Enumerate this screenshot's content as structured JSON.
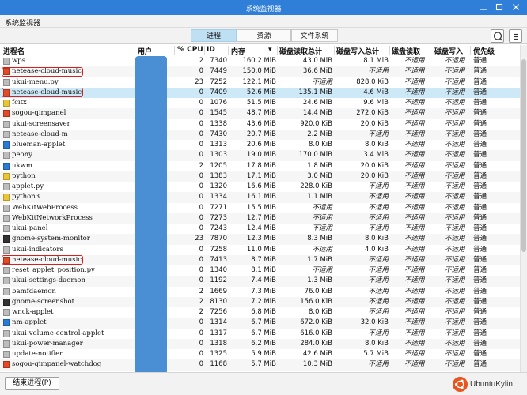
{
  "window": {
    "title": "系统监视器"
  },
  "menubar": {
    "app_label": "系统监视器"
  },
  "tabs": [
    {
      "label": "进程",
      "active": true
    },
    {
      "label": "资源",
      "active": false
    },
    {
      "label": "文件系统",
      "active": false
    }
  ],
  "toolbar": {
    "search_icon": "search-icon",
    "menu_icon": "menu-icon"
  },
  "columns": {
    "name": "进程名",
    "user": "用户",
    "cpu": "% CPU",
    "id": "ID",
    "memory": "内存",
    "disk_read_total": "磁盘读取总计",
    "disk_write_total": "磁盘写入总计",
    "disk_read": "磁盘读取",
    "disk_write": "磁盘写入",
    "priority": "优先级",
    "sort_indicator": "▾"
  },
  "processes": [
    {
      "icon": "gray",
      "name": "wps",
      "cpu": "2",
      "id": "7340",
      "mem": "160.2 MiB",
      "rtotal": "43.0 MiB",
      "wtotal": "8.1 MiB",
      "read": "不适用",
      "write": "不适用",
      "priority": "普通"
    },
    {
      "icon": "music",
      "name": "netease-cloud-music",
      "cpu": "0",
      "id": "7449",
      "mem": "150.0 MiB",
      "rtotal": "36.6 MiB",
      "wtotal": "不适用",
      "read": "不适用",
      "write": "不适用",
      "priority": "普通"
    },
    {
      "icon": "gray",
      "name": "ukui-menu.py",
      "cpu": "23",
      "id": "7252",
      "mem": "122.1 MiB",
      "rtotal": "不适用",
      "wtotal": "828.0 KiB",
      "read": "不适用",
      "write": "不适用",
      "priority": "普通"
    },
    {
      "icon": "music",
      "name": "netease-cloud-music",
      "cpu": "0",
      "id": "7409",
      "mem": "52.6 MiB",
      "rtotal": "135.1 MiB",
      "wtotal": "4.6 MiB",
      "read": "不适用",
      "write": "不适用",
      "priority": "普通"
    },
    {
      "icon": "yellow",
      "name": "fcitx",
      "cpu": "0",
      "id": "1076",
      "mem": "51.5 MiB",
      "rtotal": "24.6 MiB",
      "wtotal": "9.6 MiB",
      "read": "不适用",
      "write": "不适用",
      "priority": "普通"
    },
    {
      "icon": "music",
      "name": "sogou-qimpanel",
      "cpu": "0",
      "id": "1545",
      "mem": "48.7 MiB",
      "rtotal": "14.4 MiB",
      "wtotal": "272.0 KiB",
      "read": "不适用",
      "write": "不适用",
      "priority": "普通"
    },
    {
      "icon": "gray",
      "name": "ukui-screensaver",
      "cpu": "0",
      "id": "1338",
      "mem": "43.6 MiB",
      "rtotal": "920.0 KiB",
      "wtotal": "20.0 KiB",
      "read": "不适用",
      "write": "不适用",
      "priority": "普通"
    },
    {
      "icon": "gray",
      "name": "netease-cloud-m",
      "cpu": "0",
      "id": "7430",
      "mem": "20.7 MiB",
      "rtotal": "2.2 MiB",
      "wtotal": "不适用",
      "read": "不适用",
      "write": "不适用",
      "priority": "普通"
    },
    {
      "icon": "blue",
      "name": "blueman-applet",
      "cpu": "0",
      "id": "1313",
      "mem": "20.6 MiB",
      "rtotal": "8.0 KiB",
      "wtotal": "8.0 KiB",
      "read": "不适用",
      "write": "不适用",
      "priority": "普通"
    },
    {
      "icon": "gray",
      "name": "peony",
      "cpu": "0",
      "id": "1303",
      "mem": "19.0 MiB",
      "rtotal": "170.0 MiB",
      "wtotal": "3.4 MiB",
      "read": "不适用",
      "write": "不适用",
      "priority": "普通"
    },
    {
      "icon": "blue",
      "name": "ukwm",
      "cpu": "2",
      "id": "1205",
      "mem": "17.8 MiB",
      "rtotal": "1.8 MiB",
      "wtotal": "20.0 KiB",
      "read": "不适用",
      "write": "不适用",
      "priority": "普通"
    },
    {
      "icon": "yellow",
      "name": "python",
      "cpu": "0",
      "id": "1383",
      "mem": "17.1 MiB",
      "rtotal": "3.0 MiB",
      "wtotal": "20.0 KiB",
      "read": "不适用",
      "write": "不适用",
      "priority": "普通"
    },
    {
      "icon": "gray",
      "name": "applet.py",
      "cpu": "0",
      "id": "1320",
      "mem": "16.6 MiB",
      "rtotal": "228.0 KiB",
      "wtotal": "不适用",
      "read": "不适用",
      "write": "不适用",
      "priority": "普通"
    },
    {
      "icon": "yellow",
      "name": "python3",
      "cpu": "0",
      "id": "1334",
      "mem": "16.1 MiB",
      "rtotal": "1.1 MiB",
      "wtotal": "不适用",
      "read": "不适用",
      "write": "不适用",
      "priority": "普通"
    },
    {
      "icon": "gray",
      "name": "WebKitWebProcess",
      "cpu": "0",
      "id": "7271",
      "mem": "15.5 MiB",
      "rtotal": "不适用",
      "wtotal": "不适用",
      "read": "不适用",
      "write": "不适用",
      "priority": "普通"
    },
    {
      "icon": "gray",
      "name": "WebKitNetworkProcess",
      "cpu": "0",
      "id": "7273",
      "mem": "12.7 MiB",
      "rtotal": "不适用",
      "wtotal": "不适用",
      "read": "不适用",
      "write": "不适用",
      "priority": "普通"
    },
    {
      "icon": "gray",
      "name": "ukui-panel",
      "cpu": "0",
      "id": "7243",
      "mem": "12.4 MiB",
      "rtotal": "不适用",
      "wtotal": "不适用",
      "read": "不适用",
      "write": "不适用",
      "priority": "普通"
    },
    {
      "icon": "dark",
      "name": "gnome-system-monitor",
      "cpu": "23",
      "id": "7870",
      "mem": "12.3 MiB",
      "rtotal": "8.3 MiB",
      "wtotal": "8.0 KiB",
      "read": "不适用",
      "write": "不适用",
      "priority": "普通"
    },
    {
      "icon": "gray",
      "name": "ukui-indicators",
      "cpu": "0",
      "id": "7258",
      "mem": "11.0 MiB",
      "rtotal": "不适用",
      "wtotal": "4.0 KiB",
      "read": "不适用",
      "write": "不适用",
      "priority": "普通"
    },
    {
      "icon": "music",
      "name": "netease-cloud-music",
      "cpu": "0",
      "id": "7413",
      "mem": "8.7 MiB",
      "rtotal": "1.7 MiB",
      "wtotal": "不适用",
      "read": "不适用",
      "write": "不适用",
      "priority": "普通"
    },
    {
      "icon": "gray",
      "name": "reset_applet_position.py",
      "cpu": "0",
      "id": "1340",
      "mem": "8.1 MiB",
      "rtotal": "不适用",
      "wtotal": "不适用",
      "read": "不适用",
      "write": "不适用",
      "priority": "普通"
    },
    {
      "icon": "gray",
      "name": "ukui-settings-daemon",
      "cpu": "0",
      "id": "1192",
      "mem": "7.4 MiB",
      "rtotal": "1.3 MiB",
      "wtotal": "不适用",
      "read": "不适用",
      "write": "不适用",
      "priority": "普通"
    },
    {
      "icon": "gray",
      "name": "bamfdaemon",
      "cpu": "2",
      "id": "1669",
      "mem": "7.3 MiB",
      "rtotal": "76.0 KiB",
      "wtotal": "不适用",
      "read": "不适用",
      "write": "不适用",
      "priority": "普通"
    },
    {
      "icon": "dark",
      "name": "gnome-screenshot",
      "cpu": "2",
      "id": "8130",
      "mem": "7.2 MiB",
      "rtotal": "156.0 KiB",
      "wtotal": "不适用",
      "read": "不适用",
      "write": "不适用",
      "priority": "普通"
    },
    {
      "icon": "gray",
      "name": "wnck-applet",
      "cpu": "2",
      "id": "7256",
      "mem": "6.8 MiB",
      "rtotal": "8.0 KiB",
      "wtotal": "不适用",
      "read": "不适用",
      "write": "不适用",
      "priority": "普通"
    },
    {
      "icon": "blue",
      "name": "nm-applet",
      "cpu": "0",
      "id": "1314",
      "mem": "6.7 MiB",
      "rtotal": "672.0 KiB",
      "wtotal": "32.0 KiB",
      "read": "不适用",
      "write": "不适用",
      "priority": "普通"
    },
    {
      "icon": "gray",
      "name": "ukui-volume-control-applet",
      "cpu": "0",
      "id": "1317",
      "mem": "6.7 MiB",
      "rtotal": "616.0 KiB",
      "wtotal": "不适用",
      "read": "不适用",
      "write": "不适用",
      "priority": "普通"
    },
    {
      "icon": "gray",
      "name": "ukui-power-manager",
      "cpu": "0",
      "id": "1318",
      "mem": "6.2 MiB",
      "rtotal": "284.0 KiB",
      "wtotal": "8.0 KiB",
      "read": "不适用",
      "write": "不适用",
      "priority": "普通"
    },
    {
      "icon": "gray",
      "name": "update-notifier",
      "cpu": "0",
      "id": "1325",
      "mem": "5.9 MiB",
      "rtotal": "42.6 MiB",
      "wtotal": "5.7 MiB",
      "read": "不适用",
      "write": "不适用",
      "priority": "普通"
    },
    {
      "icon": "music",
      "name": "sogou-qimpanel-watchdog",
      "cpu": "0",
      "id": "1168",
      "mem": "5.7 MiB",
      "rtotal": "10.3 MiB",
      "wtotal": "不适用",
      "read": "不适用",
      "write": "不适用",
      "priority": "普通"
    }
  ],
  "selected_row": 3,
  "highlighted_rows": [
    1,
    3,
    19
  ],
  "footer": {
    "end_process_label": "结束进程(P)",
    "brand_text": "UbuntuKylin"
  },
  "colors": {
    "titlebar": "#2f7ed8",
    "selection": "#cde8f6",
    "highlight": "#d62020",
    "user_mask": "#4a8fd4"
  }
}
